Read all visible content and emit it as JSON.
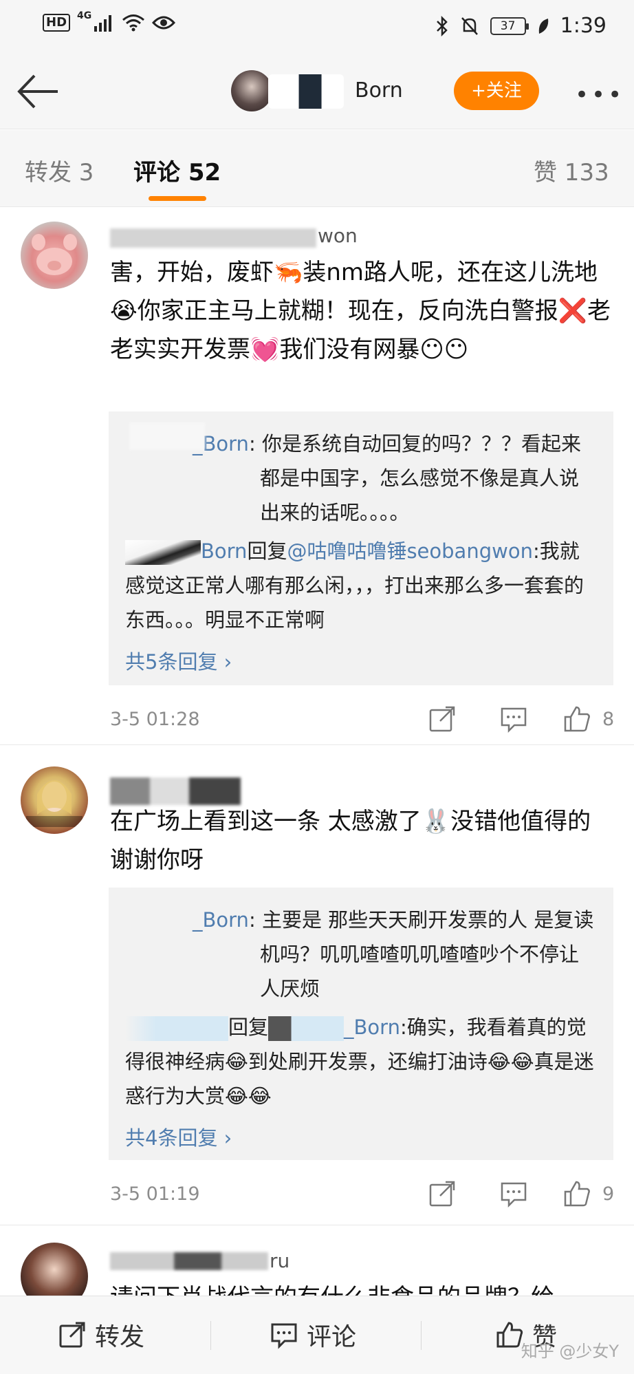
{
  "status_bar": {
    "hd": "HD",
    "network": "4G",
    "battery": "37",
    "time": "1:39"
  },
  "header": {
    "author_name": "Born",
    "follow_label": "+关注",
    "more_label": "•••"
  },
  "tabs": {
    "repost": "转发 3",
    "comment": "评论 52",
    "like": "赞 133"
  },
  "comments": [
    {
      "username_suffix": "won",
      "text": "害，开始，废虾🦐装nm路人呢，还在这儿洗地😭你家正主马上就糊！现在，反向洗白警报❌老老实实开发票💓我们没有网暴😶😶",
      "replies": [
        {
          "name": "_Born",
          "sep": ": ",
          "text": "你是系统自动回复的吗？？？看起来都是中国字，怎么感觉不像是真人说出来的话呢。。。。"
        },
        {
          "name": "Born",
          "mid": "回复",
          "target": "@咕噜咕噜锤seobangwon",
          "sep": ":",
          "text": "我就感觉这正常人哪有那么闲，，，打出来那么多一套套的东西。。。明显不正常啊"
        }
      ],
      "more_replies": "共5条回复 ›",
      "time": "3-5 01:28",
      "likes": "8"
    },
    {
      "username_suffix": "",
      "text": "在广场上看到这一条 太感激了🐰没错他值得的 谢谢你呀",
      "replies": [
        {
          "name": "_Born",
          "sep": ": ",
          "text": "主要是 那些天天刷开发票的人 是复读机吗？叽叽喳喳叽叽喳喳吵个不停让人厌烦"
        },
        {
          "name": "",
          "mid": "回复",
          "target": "_Born",
          "sep": ":",
          "text": "确实，我看着真的觉得很神经病😂到处刷开发票，还编打油诗😂😂真是迷惑行为大赏😂😂"
        }
      ],
      "more_replies": "共4条回复 ›",
      "time": "3-5 01:19",
      "likes": "9"
    },
    {
      "username_suffix": "ru",
      "text": "请问下肖战代言的有什么非食品的品牌？给"
    }
  ],
  "bottom_bar": {
    "repost": "转发",
    "comment": "评论",
    "like": "赞",
    "watermark": "知乎 @少女Y"
  }
}
